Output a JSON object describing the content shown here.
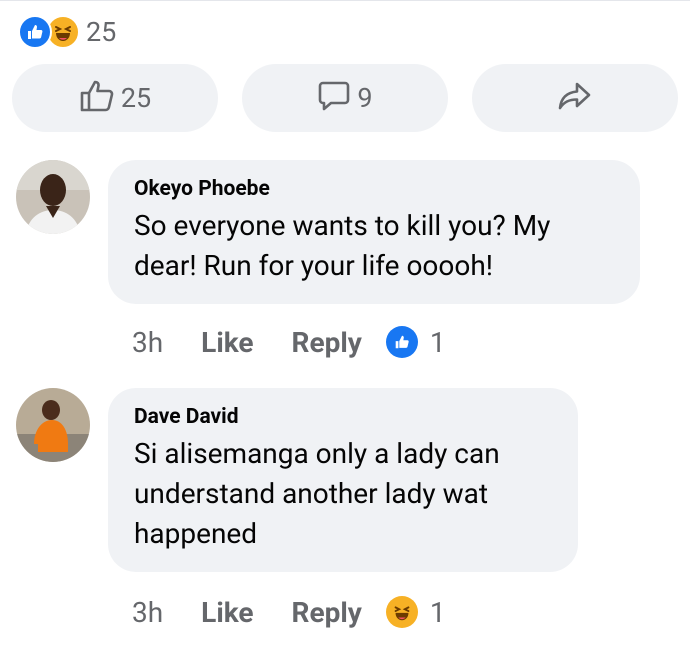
{
  "reactions": {
    "count": "25",
    "icons": [
      "like-icon",
      "haha-icon"
    ]
  },
  "actions": {
    "like_count": "25",
    "comment_count": "9",
    "share_icon": "share-arrow-icon"
  },
  "comments": [
    {
      "author": "Okeyo Phoebe",
      "text": "So everyone wants to kill you? My dear! Run for your life ooooh!",
      "time": "3h",
      "like_label": "Like",
      "reply_label": "Reply",
      "reaction_icon": "like-icon",
      "reaction_count": "1"
    },
    {
      "author": "Dave David",
      "text": "Si alisemanga only a lady can understand another lady wat happened",
      "time": "3h",
      "like_label": "Like",
      "reply_label": "Reply",
      "reaction_icon": "haha-icon",
      "reaction_count": "1"
    }
  ],
  "colors": {
    "accent": "#1877f2",
    "haha": "#f7b125",
    "bubble": "#f0f2f5",
    "secondary_text": "#65676b"
  }
}
